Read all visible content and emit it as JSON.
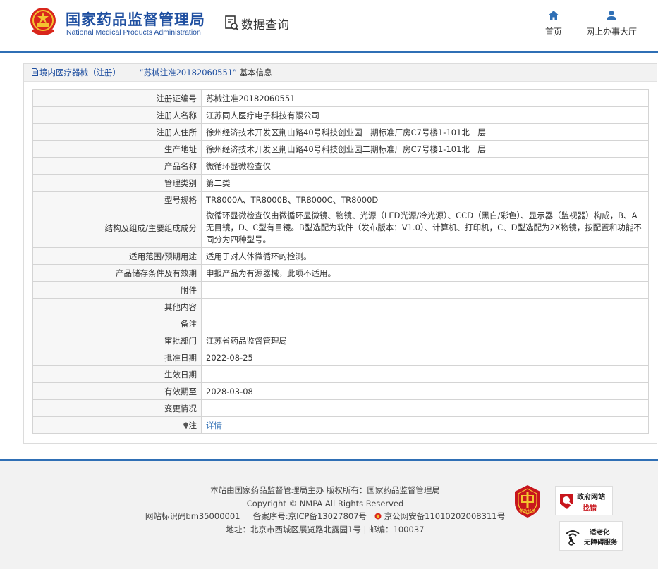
{
  "header": {
    "org_name_cn": "国家药品监督管理局",
    "org_name_en": "National Medical Products Administration",
    "page_title": "数据查询",
    "nav": [
      {
        "label": "首页",
        "icon": "home-icon"
      },
      {
        "label": "网上办事大厅",
        "icon": "user-icon"
      }
    ]
  },
  "breadcrumb": {
    "category": "境内医疗器械（注册）",
    "separator": "——",
    "record": "“苏械注准20182060551”",
    "suffix": "基本信息"
  },
  "rows": [
    {
      "label": "注册证编号",
      "value": "苏械注准20182060551"
    },
    {
      "label": "注册人名称",
      "value": "江苏同人医疗电子科技有限公司"
    },
    {
      "label": "注册人住所",
      "value": "徐州经济技术开发区荆山路40号科技创业园二期标准厂房C7号楼1-101北一层"
    },
    {
      "label": "生产地址",
      "value": "徐州经济技术开发区荆山路40号科技创业园二期标准厂房C7号楼1-101北一层"
    },
    {
      "label": "产品名称",
      "value": "微循环显微检查仪"
    },
    {
      "label": "管理类别",
      "value": "第二类"
    },
    {
      "label": "型号规格",
      "value": "TR8000A、TR8000B、TR8000C、TR8000D"
    },
    {
      "label": "结构及组成/主要组成成分",
      "value": "微循环显微检查仪由微循环显微镜、物镜、光源（LED光源/冷光源）、CCD（黑白/彩色）、显示器（监视器）构成，B、A无目镜，D、C型有目镜。B型选配为软件（发布版本：V1.0）、计算机、打印机，C、D型选配为2X物镜，按配置和功能不同分为四种型号。"
    },
    {
      "label": "适用范围/预期用途",
      "value": "适用于对人体微循环的检测。"
    },
    {
      "label": "产品储存条件及有效期",
      "value": "申报产品为有源器械，此项不适用。"
    },
    {
      "label": "附件",
      "value": ""
    },
    {
      "label": "其他内容",
      "value": ""
    },
    {
      "label": "备注",
      "value": ""
    },
    {
      "label": "审批部门",
      "value": "江苏省药品监督管理局"
    },
    {
      "label": "批准日期",
      "value": "2022-08-25"
    },
    {
      "label": "生效日期",
      "value": ""
    },
    {
      "label": "有效期至",
      "value": "2028-03-08"
    },
    {
      "label": "变更情况",
      "value": ""
    }
  ],
  "note_row": {
    "label": "注",
    "link": "详情"
  },
  "footer": {
    "line1": "本站由国家药品监督管理局主办 版权所有：国家药品监督管理局",
    "line2": "Copyright © NMPA All Rights Reserved",
    "site_id": "网站标识码bm35000001",
    "icp": "备案序号:京ICP备13027807号",
    "police": "京公网安备11010202008311号",
    "address": "地址：北京市西城区展览路北露园1号 | 邮编：100037",
    "badge_party_text": "党政机关",
    "badge_error_title": "政府网站",
    "badge_error_sub": "找错",
    "badge_access_line1": "适老化",
    "badge_access_line2": "无障碍服务"
  },
  "colors": {
    "brand_blue": "#1f4fa0",
    "accent_blue": "#2f6fb5",
    "red": "#c8161d"
  }
}
